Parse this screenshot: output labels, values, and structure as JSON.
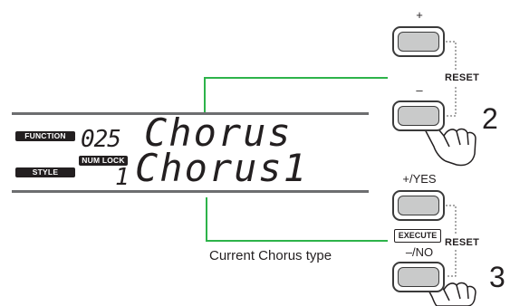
{
  "display": {
    "function_tag": "FUNCTION",
    "style_tag": "STYLE",
    "numlock_tag": "NUM LOCK",
    "function_number": "025",
    "function_name": "Chorus",
    "value_number": "1",
    "value_name": "Chorus1"
  },
  "buttons": {
    "plus_label": "+",
    "minus_label": "–",
    "yes_label": "+/YES",
    "no_label": "–/NO",
    "execute_label": "EXECUTE",
    "reset_label": "RESET"
  },
  "steps": {
    "step2": "2",
    "step3": "3"
  },
  "caption": "Current Chorus type",
  "colors": {
    "callout_line": "#2db34a",
    "button_fill": "#c9caca",
    "outline": "#3a3a3a"
  }
}
